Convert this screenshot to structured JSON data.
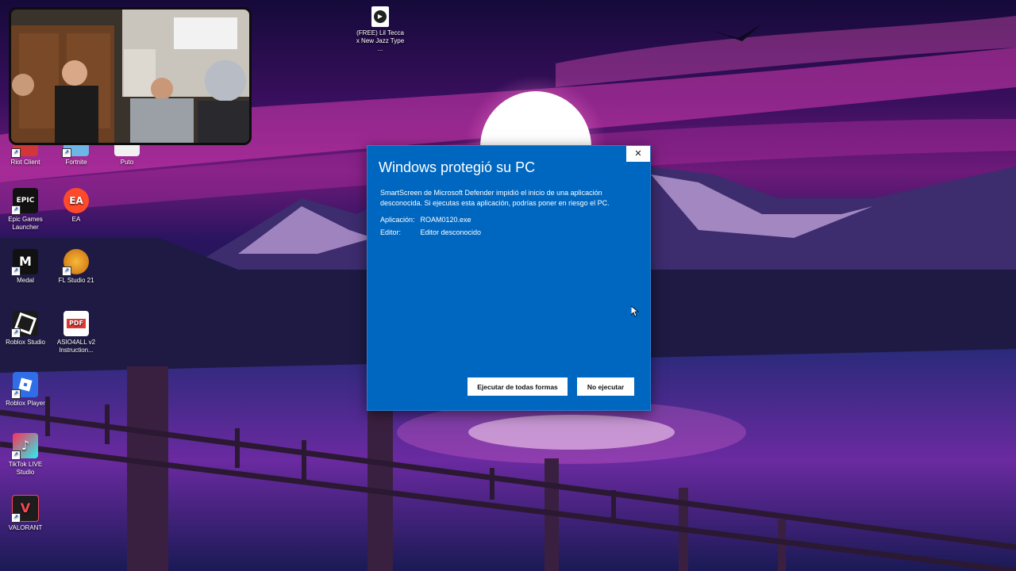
{
  "desktop": {
    "icons": [
      {
        "label": "Riot Client",
        "icon": "riot-client-icon",
        "color": "#d13639"
      },
      {
        "label": "Fortnite",
        "icon": "fortnite-icon",
        "color": "#6fb6e8"
      },
      {
        "label": "Puto",
        "icon": "folder-icon",
        "color": "#f1f1f1"
      },
      {
        "label": "Epic Games Launcher",
        "icon": "epic-games-icon",
        "color": "#111111",
        "glyph": "EPIC"
      },
      {
        "label": "EA",
        "icon": "ea-icon",
        "color": "#ff4a2a",
        "glyph": "EA"
      },
      {
        "label": "Medal",
        "icon": "medal-icon",
        "color": "#111111",
        "glyph": "M"
      },
      {
        "label": "FL Studio 21",
        "icon": "fl-studio-icon",
        "color": "#f29c1f"
      },
      {
        "label": "Roblox Studio",
        "icon": "roblox-studio-icon",
        "color": "#1b1b1b"
      },
      {
        "label": "ASIO4ALL v2 Instruction...",
        "icon": "pdf-icon",
        "color": "#e53935",
        "glyph": "PDF"
      },
      {
        "label": "Roblox Player",
        "icon": "roblox-player-icon",
        "color": "#2f6ee6"
      },
      {
        "label": "TikTok LIVE Studio",
        "icon": "tiktok-icon",
        "color": "#ff2d55"
      },
      {
        "label": "VALORANT",
        "icon": "valorant-icon",
        "color": "#1d1d1d",
        "glyph": "V"
      },
      {
        "label": "(FREE) Lil Tecca x New Jazz Type ...",
        "icon": "media-file-icon",
        "color": "#ffffff"
      }
    ]
  },
  "dialog": {
    "title": "Windows protegió su PC",
    "message": "SmartScreen de Microsoft Defender impidió el inicio de una aplicación desconocida. Si ejecutas esta aplicación, podrías poner en riesgo el PC.",
    "app_label": "Aplicación:",
    "app_value": "ROAM0120.exe",
    "publisher_label": "Editor:",
    "publisher_value": "Editor desconocido",
    "run_anyway_label": "Ejecutar de todas formas",
    "dont_run_label": "No ejecutar",
    "close_glyph": "✕",
    "accent_color": "#0067c0"
  }
}
